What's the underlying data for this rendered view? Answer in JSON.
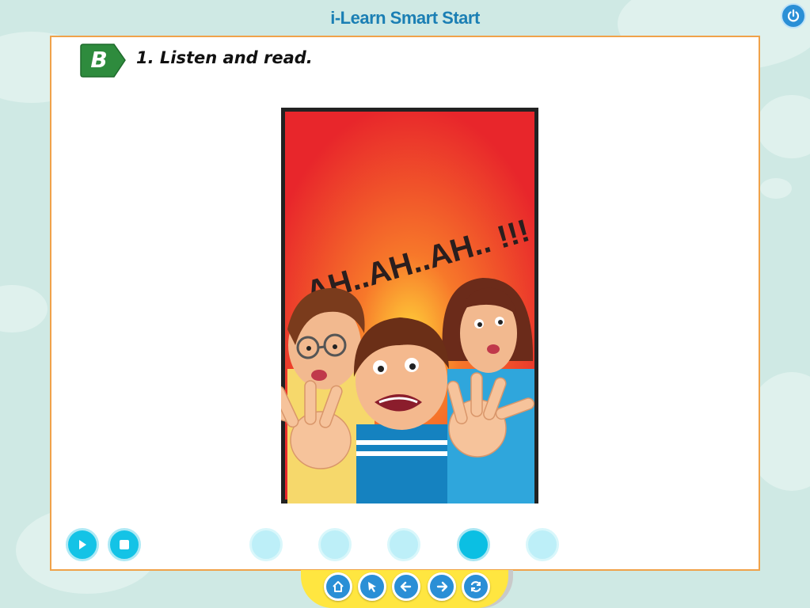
{
  "app": {
    "title": "i-Learn Smart Start"
  },
  "section": {
    "letter": "B",
    "instruction": "1. Listen and read."
  },
  "comic": {
    "exclamation": "AH..AH..AH.. !!!"
  },
  "colors": {
    "background": "#cfe9e4",
    "accent": "#1b7fb4",
    "panel_border": "#f0a24a",
    "badge_green": "#2e8b3d",
    "control_cyan": "#14c3e6",
    "nav_bar_yellow": "#ffe640",
    "comic_red": "#e8262b"
  },
  "controls": {
    "icons": [
      "play-icon",
      "stop-icon"
    ]
  },
  "pagination": {
    "count": 5,
    "active_index": 3
  },
  "nav_bar": {
    "icons": [
      "home-icon",
      "cursor-icon",
      "arrow-left-icon",
      "arrow-right-icon",
      "refresh-icon"
    ]
  }
}
